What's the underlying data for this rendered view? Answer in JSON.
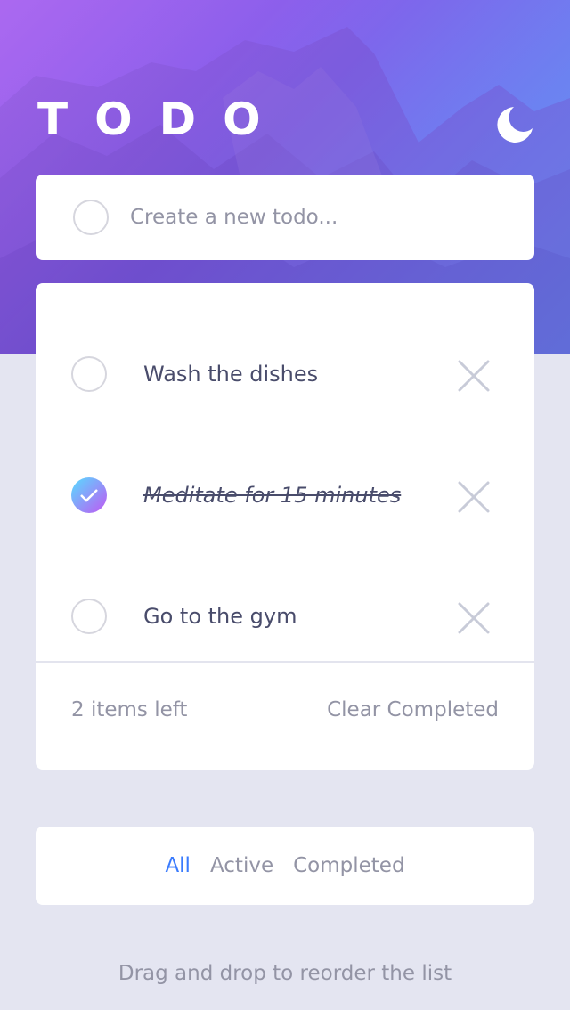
{
  "header": {
    "title": "TODO",
    "theme_icon": "moon-icon"
  },
  "create": {
    "placeholder": "Create a new todo..."
  },
  "todos": [
    {
      "text": "Wash the dishes",
      "completed": false
    },
    {
      "text": "Meditate for 15 minutes",
      "completed": true
    },
    {
      "text": "Go to the gym",
      "completed": false
    }
  ],
  "footer": {
    "items_left": "2 items left",
    "clear_label": "Clear Completed"
  },
  "filters": {
    "all": "All",
    "active": "Active",
    "completed": "Completed",
    "selected": "All"
  },
  "hint": "Drag and drop to reorder the list",
  "colors": {
    "accent": "#3a7bfd",
    "check_gradient_start": "#57ddff",
    "check_gradient_end": "#c058f3",
    "page_background": "#e4e5f1"
  }
}
